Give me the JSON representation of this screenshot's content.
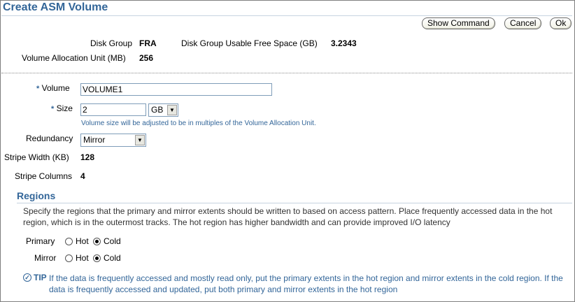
{
  "page": {
    "title": "Create ASM Volume"
  },
  "actions": {
    "show_command": "Show Command",
    "cancel": "Cancel",
    "ok": "Ok"
  },
  "info": {
    "disk_group_label": "Disk Group",
    "disk_group_value": "FRA",
    "free_space_label": "Disk Group Usable Free Space (GB)",
    "free_space_value": "3.2343",
    "alloc_unit_label": "Volume Allocation Unit (MB)",
    "alloc_unit_value": "256"
  },
  "form": {
    "required_marker": "*",
    "volume_label": "Volume",
    "volume_value": "VOLUME1",
    "size_label": "Size",
    "size_value": "2",
    "size_unit": "GB",
    "size_hint": "Volume size will be adjusted to be in multiples of the Volume Allocation Unit.",
    "redundancy_label": "Redundancy",
    "redundancy_value": "Mirror",
    "stripe_width_label": "Stripe Width (KB)",
    "stripe_width_value": "128",
    "stripe_columns_label": "Stripe Columns",
    "stripe_columns_value": "4"
  },
  "regions": {
    "heading": "Regions",
    "description": "Specify the regions that the primary and mirror extents should be written to based on access pattern. Place frequently accessed data in the hot region, which is in the outermost tracks. The hot region has higher bandwidth and can provide improved I/O latency",
    "primary_label": "Primary",
    "mirror_label": "Mirror",
    "hot_label": "Hot",
    "cold_label": "Cold",
    "primary_selected": "Cold",
    "mirror_selected": "Cold"
  },
  "tip": {
    "label": "TIP",
    "text": "If the data is frequently accessed and mostly read only, put the primary extents in the hot region and mirror extents in the cold region. If the data is frequently accessed and updated, put both primary and mirror extents in the hot region"
  }
}
